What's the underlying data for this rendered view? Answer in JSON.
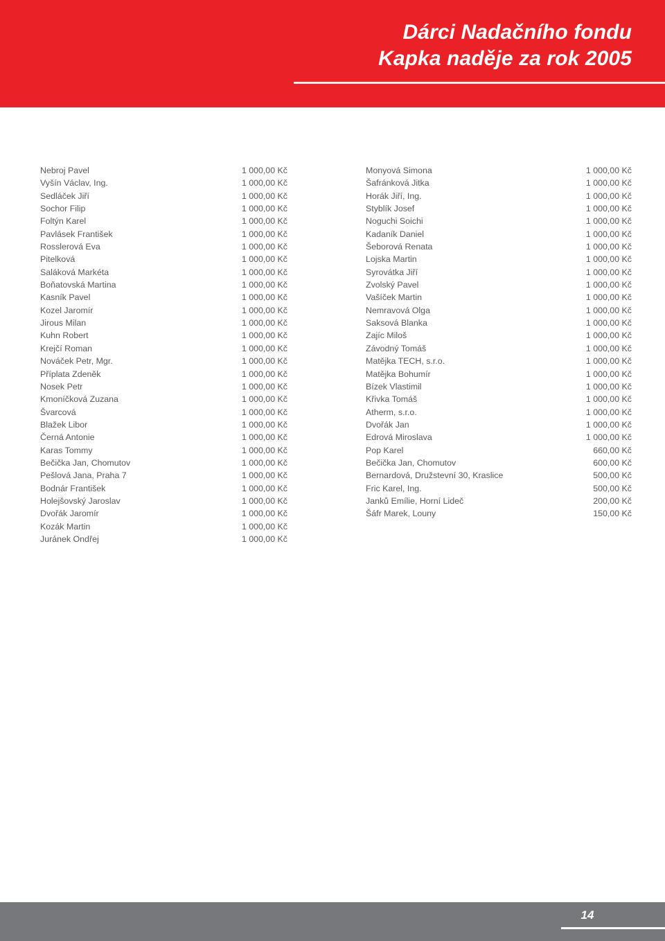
{
  "header": {
    "title_line_1": "Dárci Nadačního fondu",
    "title_line_2": "Kapka naděje za rok 2005",
    "background_color": "#ea2127",
    "text_color": "#ffffff"
  },
  "footer": {
    "page_number": "14",
    "background_color": "#77787b",
    "text_color": "#ffffff"
  },
  "colors": {
    "brand_red": "#ea2127",
    "footer_gray": "#77787b",
    "body_text": "#58595b",
    "page_background": "#ffffff"
  },
  "donors": {
    "currency_suffix": "Kč",
    "left_column": [
      {
        "name": "Nebroj Pavel",
        "amount": "1 000,00 Kč"
      },
      {
        "name": "Vyšín Václav, Ing.",
        "amount": "1 000,00 Kč"
      },
      {
        "name": "Sedláček Jiří",
        "amount": "1 000,00 Kč"
      },
      {
        "name": "Sochor Filip",
        "amount": "1 000,00 Kč"
      },
      {
        "name": "Foltýn Karel",
        "amount": "1 000,00 Kč"
      },
      {
        "name": "Pavlásek František",
        "amount": "1 000,00 Kč"
      },
      {
        "name": "Rosslerová Eva",
        "amount": "1 000,00 Kč"
      },
      {
        "name": "Pitelková",
        "amount": "1 000,00 Kč"
      },
      {
        "name": "Saláková Markéta",
        "amount": "1 000,00 Kč"
      },
      {
        "name": "Boňatovská Martina",
        "amount": "1 000,00 Kč"
      },
      {
        "name": "Kasník Pavel",
        "amount": "1 000,00 Kč"
      },
      {
        "name": "Kozel Jaromír",
        "amount": "1 000,00 Kč"
      },
      {
        "name": "Jirous Milan",
        "amount": "1 000,00 Kč"
      },
      {
        "name": "Kuhn Robert",
        "amount": "1 000,00 Kč"
      },
      {
        "name": "Krejčí Roman",
        "amount": "1 000,00 Kč"
      },
      {
        "name": "Nováček Petr, Mgr.",
        "amount": "1 000,00 Kč"
      },
      {
        "name": "Příplata Zdeněk",
        "amount": "1 000,00 Kč"
      },
      {
        "name": "Nosek Petr",
        "amount": "1 000,00 Kč"
      },
      {
        "name": "Kmoníčková Zuzana",
        "amount": "1 000,00 Kč"
      },
      {
        "name": "Švarcová",
        "amount": "1 000,00 Kč"
      },
      {
        "name": "Blažek Libor",
        "amount": "1 000,00 Kč"
      },
      {
        "name": "Černá Antonie",
        "amount": "1 000,00 Kč"
      },
      {
        "name": "Karas Tommy",
        "amount": "1 000,00 Kč"
      },
      {
        "name": "Bečička Jan, Chomutov",
        "amount": "1 000,00 Kč"
      },
      {
        "name": "Pešlová Jana, Praha 7",
        "amount": "1 000,00 Kč"
      },
      {
        "name": "Bodnár František",
        "amount": "1 000,00 Kč"
      },
      {
        "name": "Holejšovský Jaroslav",
        "amount": "1 000,00 Kč"
      },
      {
        "name": "Dvořák Jaromír",
        "amount": "1 000,00 Kč"
      },
      {
        "name": "Kozák Martin",
        "amount": "1 000,00 Kč"
      },
      {
        "name": "Juránek Ondřej",
        "amount": "1 000,00 Kč"
      }
    ],
    "right_column": [
      {
        "name": "Monyová Simona",
        "amount": "1 000,00 Kč"
      },
      {
        "name": "Šafránková Jitka",
        "amount": "1 000,00 Kč"
      },
      {
        "name": "Horák Jiří, Ing.",
        "amount": "1 000,00 Kč"
      },
      {
        "name": "Styblík Josef",
        "amount": "1 000,00 Kč"
      },
      {
        "name": "Noguchi Soichi",
        "amount": "1 000,00 Kč"
      },
      {
        "name": "Kadaník Daniel",
        "amount": "1 000,00 Kč"
      },
      {
        "name": "Šeborová Renata",
        "amount": "1 000,00 Kč"
      },
      {
        "name": "Lojska Martin",
        "amount": "1 000,00 Kč"
      },
      {
        "name": "Syrovátka Jiří",
        "amount": "1 000,00 Kč"
      },
      {
        "name": "Zvolský Pavel",
        "amount": "1 000,00 Kč"
      },
      {
        "name": "Vašíček Martin",
        "amount": "1 000,00 Kč"
      },
      {
        "name": "Nemravová Olga",
        "amount": "1 000,00 Kč"
      },
      {
        "name": "Saksová Blanka",
        "amount": "1 000,00 Kč"
      },
      {
        "name": "Zajíc Miloš",
        "amount": "1 000,00 Kč"
      },
      {
        "name": "Závodný Tomáš",
        "amount": "1 000,00 Kč"
      },
      {
        "name": "Matějka TECH, s.r.o.",
        "amount": "1 000,00 Kč"
      },
      {
        "name": "Matějka Bohumír",
        "amount": "1 000,00 Kč"
      },
      {
        "name": "Bízek Vlastimil",
        "amount": "1 000,00 Kč"
      },
      {
        "name": "Křivka Tomáš",
        "amount": "1 000,00 Kč"
      },
      {
        "name": "Atherm, s.r.o.",
        "amount": "1 000,00 Kč"
      },
      {
        "name": "Dvořák Jan",
        "amount": "1 000,00 Kč"
      },
      {
        "name": "Edrová Miroslava",
        "amount": "1 000,00 Kč"
      },
      {
        "name": "Pop Karel",
        "amount": "660,00 Kč"
      },
      {
        "name": "Bečička Jan, Chomutov",
        "amount": "600,00 Kč"
      },
      {
        "name": "Bernardová, Družstevní 30, Kraslice",
        "amount": "500,00 Kč"
      },
      {
        "name": "Fric Karel, Ing.",
        "amount": "500,00 Kč"
      },
      {
        "name": "Janků Emílie, Horní Lideč",
        "amount": "200,00 Kč"
      },
      {
        "name": "Šáfr Marek, Louny",
        "amount": "150,00 Kč"
      }
    ]
  }
}
